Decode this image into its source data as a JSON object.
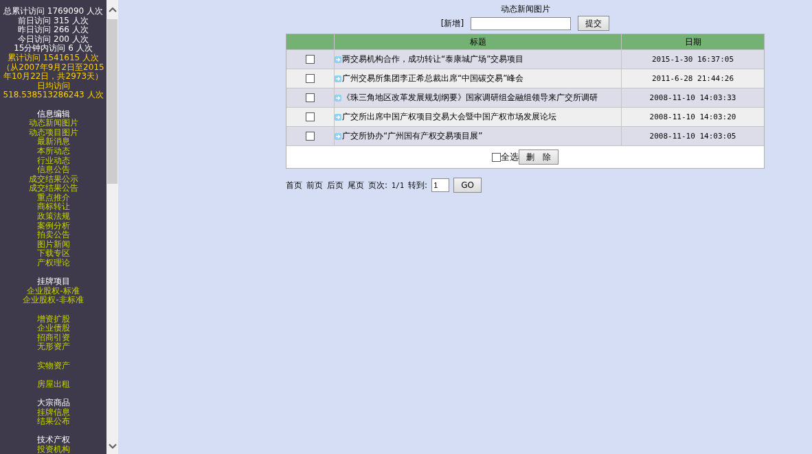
{
  "sidebar": {
    "stats": [
      {
        "kind": "total",
        "text": "总累计访问 1769090 人次"
      },
      {
        "kind": "total",
        "text": "前日访问 315 人次"
      },
      {
        "kind": "total",
        "text": "昨日访问 266 人次"
      },
      {
        "kind": "total",
        "text": "今日访问 200 人次"
      },
      {
        "kind": "total",
        "text": "15分钟内访问 6 人次"
      },
      {
        "kind": "highlight",
        "text": "累计访问 1541615 人次"
      },
      {
        "kind": "highlight",
        "text": "（从2007年9月2日至2015年10月22日，共2973天）"
      },
      {
        "kind": "highlight",
        "text": "日均访问 518.538513286243 人次"
      }
    ],
    "groups": [
      {
        "heading": "信息编辑",
        "items": [
          "动态新闻图片",
          "动态项目图片",
          "最新消息",
          "本所动态",
          "行业动态",
          "信息公告",
          "成交结果公示",
          "成交结果公告",
          "重点推介",
          "商标转让",
          "政策法规",
          "案例分析",
          "拍卖公告",
          "图片新闻",
          "下载专区",
          "产权理论"
        ]
      },
      {
        "heading": "挂牌项目",
        "items": [
          "企业股权-标准",
          "企业股权-非标准"
        ]
      },
      {
        "items": [
          "增资扩股",
          "企业债股",
          "招商引资",
          "无形资产"
        ]
      },
      {
        "items": [
          "实物资产"
        ]
      },
      {
        "items": [
          "房屋出租"
        ]
      },
      {
        "heading": "大宗商品",
        "items": [
          "挂牌信息",
          "结果公布"
        ]
      },
      {
        "heading": "技术产权",
        "items": [
          "投资机构"
        ]
      }
    ]
  },
  "page_title": "动态新闻图片",
  "add_form": {
    "label": "[新增]",
    "submit": "提交"
  },
  "table": {
    "columns": [
      "标题",
      "日期"
    ],
    "rows": [
      {
        "checked": false,
        "title": "两交易机构合作，成功转让“泰康城广场”交易项目",
        "date": "2015-1-30 16:37:05"
      },
      {
        "checked": false,
        "title": "广州交易所集团李正希总裁出席“中国碳交易”峰会",
        "date": "2011-6-28 21:44:26"
      },
      {
        "checked": false,
        "title": "《珠三角地区改革发展规划纲要》国家调研组金融组领导来广交所调研",
        "date": "2008-11-10 14:03:33"
      },
      {
        "checked": false,
        "title": "广交所出席中国产权项目交易大会暨中国产权市场发展论坛",
        "date": "2008-11-10 14:03:20"
      },
      {
        "checked": false,
        "title": "广交所协办“广州国有产权交易项目展”",
        "date": "2008-11-10 14:03:05"
      }
    ],
    "select_all": {
      "label": "全选",
      "checked": false
    },
    "delete": "删　除"
  },
  "pager": {
    "links": [
      "首页",
      "前页",
      "后页",
      "尾页"
    ],
    "page_label": "页次:",
    "page": "1/1",
    "goto_label": "转到:",
    "goto_value": "1",
    "go": "GO"
  }
}
